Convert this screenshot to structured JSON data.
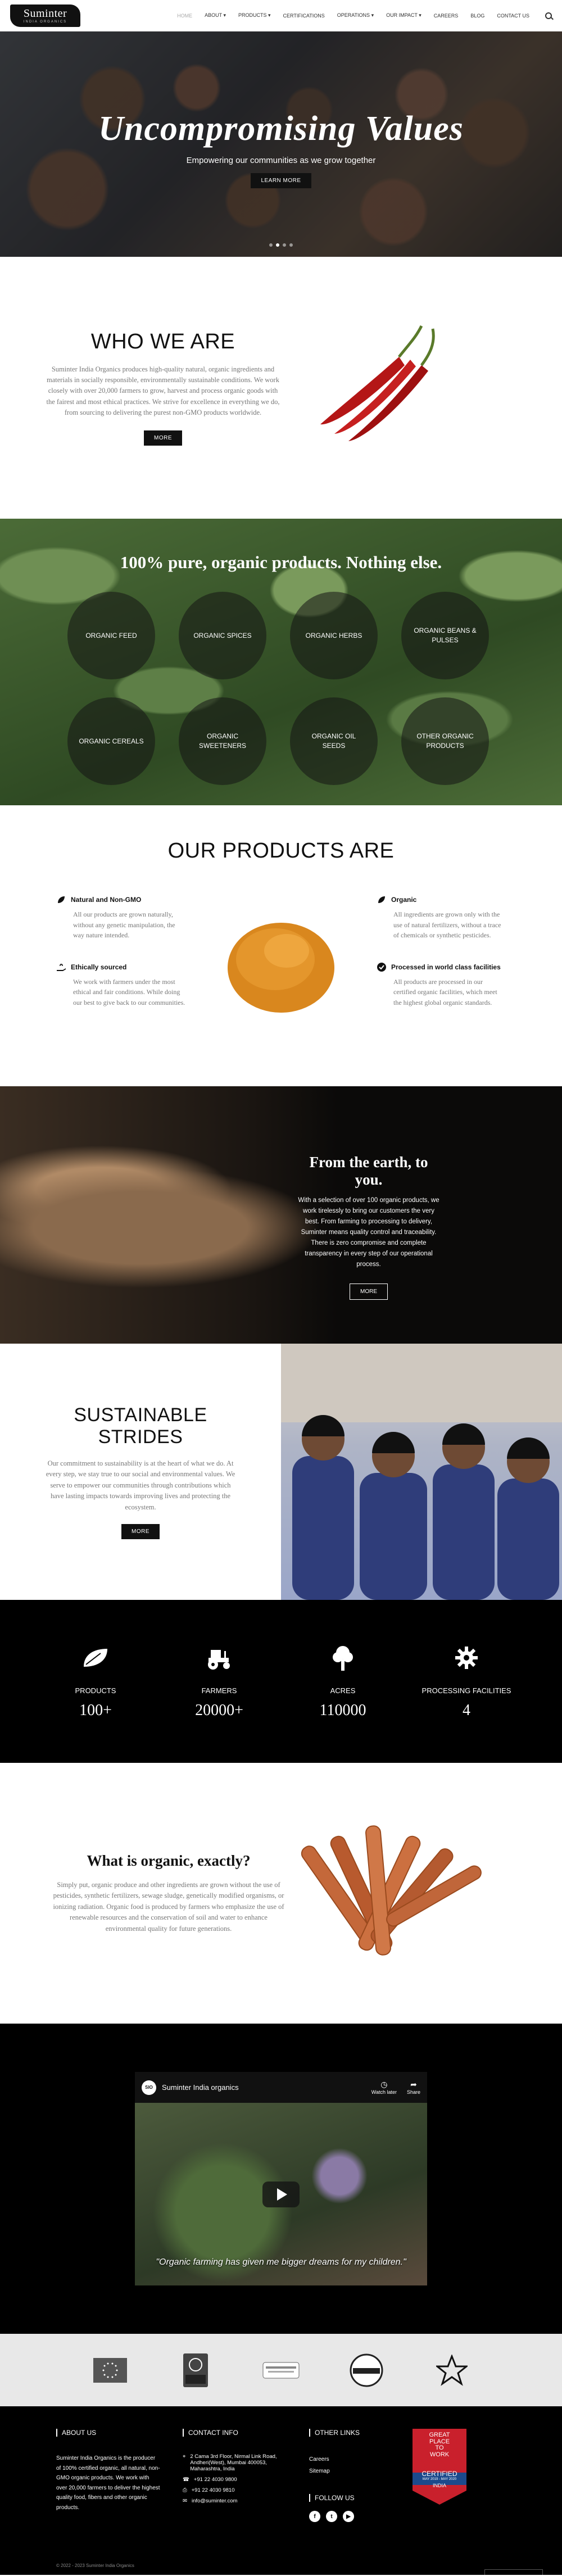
{
  "header": {
    "logo_main": "Suminter",
    "logo_sub": "INDIA ORGANICS",
    "nav": [
      {
        "label": "HOME",
        "active": true
      },
      {
        "label": "ABOUT",
        "dropdown": true
      },
      {
        "label": "PRODUCTS",
        "dropdown": true
      },
      {
        "label": "CERTIFICATIONS"
      },
      {
        "label": "OPERATIONS",
        "dropdown": true
      },
      {
        "label": "OUR IMPACT",
        "dropdown": true
      },
      {
        "label": "CAREERS"
      },
      {
        "label": "BLOG"
      },
      {
        "label": "CONTACT US"
      }
    ],
    "search_icon": "search-icon"
  },
  "hero": {
    "title": "Uncompromising Values",
    "subtitle": "Empowering our communities as we grow together",
    "button": "LEARN MORE",
    "dots": 4,
    "active_dot": 1
  },
  "who": {
    "title": "WHO WE ARE",
    "text": "Suminter India Organics produces high-quality natural, organic ingredients and materials in socially responsible, environmentally sustainable conditions. We work closely with over 20,000 farmers to grow, harvest and process organic goods with the fairest and most ethical practices. We strive for excellence in everything we do, from sourcing to delivering the purest non-GMO products worldwide.",
    "button": "MORE"
  },
  "categories": {
    "title": "100% pure, organic products. Nothing else.",
    "items": [
      "ORGANIC FEED",
      "ORGANIC SPICES",
      "ORGANIC HERBS",
      "ORGANIC BEANS & PULSES",
      "ORGANIC CEREALS",
      "ORGANIC SWEETENERS",
      "ORGANIC OIL SEEDS",
      "OTHER ORGANIC PRODUCTS"
    ]
  },
  "features": {
    "title": "OUR PRODUCTS ARE",
    "left": [
      {
        "title": "Natural and Non-GMO",
        "icon": "leaf-icon",
        "text": "All our products are grown naturally, without any genetic manipulation, the way nature intended."
      },
      {
        "title": "Ethically sourced",
        "icon": "hand-plant-icon",
        "text": "We work with farmers under the most ethical and fair conditions. While doing our best to give back to our communities."
      }
    ],
    "right": [
      {
        "title": "Organic",
        "icon": "leaf-icon",
        "text": "All ingredients are grown only with the use of natural fertilizers, without a trace of chemicals or synthetic pesticides."
      },
      {
        "title": "Processed in world class facilities",
        "icon": "check-circle-icon",
        "text": "All products are processed in our certified organic facilities, which meet the highest global organic standards."
      }
    ]
  },
  "earth": {
    "title": "From the earth, to you.",
    "text": "With a selection of over 100 organic products, we work tirelessly to bring our customers the very best. From farming to processing to delivery, Suminter means quality control and traceability. There is zero compromise and complete transparency in every step of our operational process.",
    "button": "MORE"
  },
  "sustainable": {
    "title": "SUSTAINABLE STRIDES",
    "text": "Our commitment to sustainability is at the heart of what we do. At every step, we stay true to our social and environmental values. We serve to empower our communities through contributions which have lasting impacts towards improving lives and protecting the ecosystem.",
    "button": "MORE"
  },
  "stats": [
    {
      "label": "PRODUCTS",
      "value": "100+",
      "icon": "leaf-icon"
    },
    {
      "label": "FARMERS",
      "value": "20000+",
      "icon": "tractor-icon"
    },
    {
      "label": "ACRES",
      "value": "110000",
      "icon": "tree-icon"
    },
    {
      "label": "PROCESSING FACILITIES",
      "value": "4",
      "icon": "gear-icon"
    }
  ],
  "what": {
    "title": "What is organic, exactly?",
    "text": "Simply put, organic produce and other ingredients are grown without the use of pesticides, synthetic fertilizers, sewage sludge, genetically modified organisms, or ionizing radiation. Organic food is produced by farmers who emphasize the use of renewable resources and the conservation of soil and water to enhance environmental quality for future generations."
  },
  "video": {
    "channel": "Suminter India organics",
    "watch_later": "Watch later",
    "share": "Share",
    "caption": "\"Organic farming has given me bigger dreams for my children.\""
  },
  "certs": [
    "eu-organic-icon",
    "fair-trade-icon",
    "bio-suisse-icon",
    "usda-organic-icon",
    "star-icon"
  ],
  "footer": {
    "about_head": "ABOUT US",
    "about_text": "Suminter India Organics is the producer of 100% certified organic, all natural, non-GMO organic products. We work with over 20,000 farmers to deliver the highest quality food, fibers and other organic products.",
    "contact_head": "CONTACT INFO",
    "contact": [
      {
        "icon": "location-icon",
        "text": "2 Cama 3rd Floor, Nirmal Link Road, Andheri(West), Mumbai 400053, Maharashtra, India"
      },
      {
        "icon": "phone-icon",
        "text": "+91 22 4030 9800"
      },
      {
        "icon": "fax-icon",
        "text": "+91 22 4030 9810"
      },
      {
        "icon": "mail-icon",
        "text": "info@suminter.com"
      }
    ],
    "links_head": "OTHER LINKS",
    "links": [
      "Careers",
      "Sitemap"
    ],
    "follow_head": "FOLLOW US",
    "social": [
      {
        "icon": "facebook-icon",
        "glyph": "f"
      },
      {
        "icon": "twitter-icon",
        "glyph": "t"
      },
      {
        "icon": "youtube-icon",
        "glyph": "▶"
      }
    ],
    "gptw_lines": [
      "Great",
      "Place",
      "To",
      "Work",
      "Certified",
      "MAY 2019 - MAY 2020",
      "INDIA"
    ],
    "copyright": "© 2022 - 2023 Suminter India Organics"
  }
}
